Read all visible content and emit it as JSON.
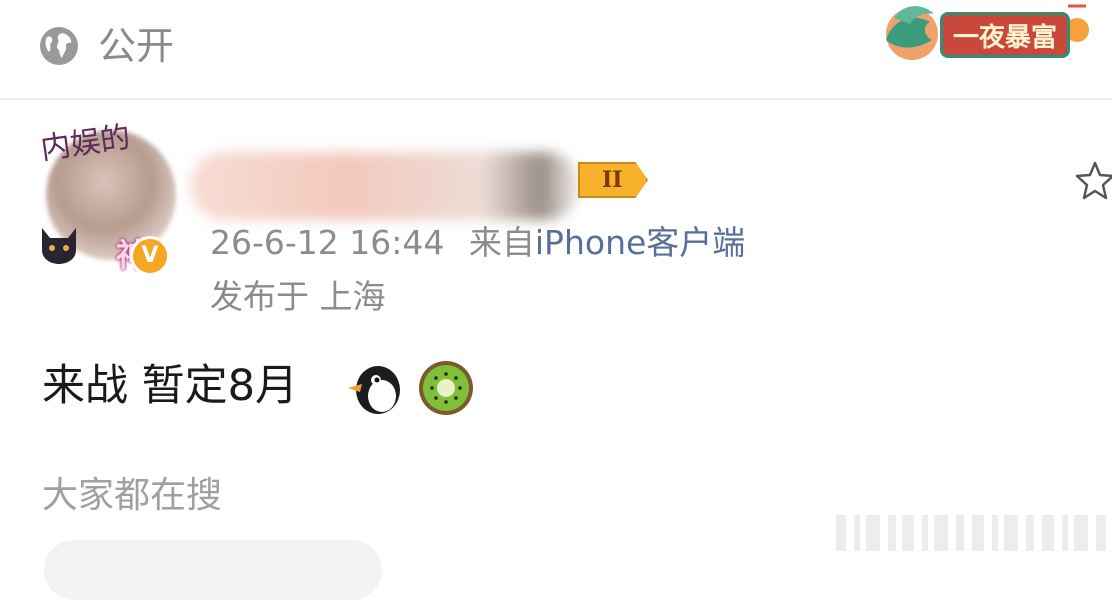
{
  "header": {
    "visibility_label": "公开",
    "visibility_icon": "globe-icon",
    "banner_text": "一夜暴富"
  },
  "post": {
    "avatar_frame_text_top": "内娱的",
    "avatar_frame_text_bottom": "神",
    "verified_badge": "V",
    "level_badge": "II",
    "timestamp": "26-6-12 16:44",
    "source_prefix": "来自",
    "source_name": "iPhone客户端",
    "location": "发布于 上海",
    "content": "来战 暂定8月",
    "emojis": [
      "penguin-emoji",
      "kiwi-emoji"
    ]
  },
  "search": {
    "heading": "大家都在搜"
  },
  "colors": {
    "accent_link": "#596f9a",
    "muted_text": "#8c8c8c",
    "verified_orange": "#f5a623",
    "level_gold": "#f7b12a"
  }
}
